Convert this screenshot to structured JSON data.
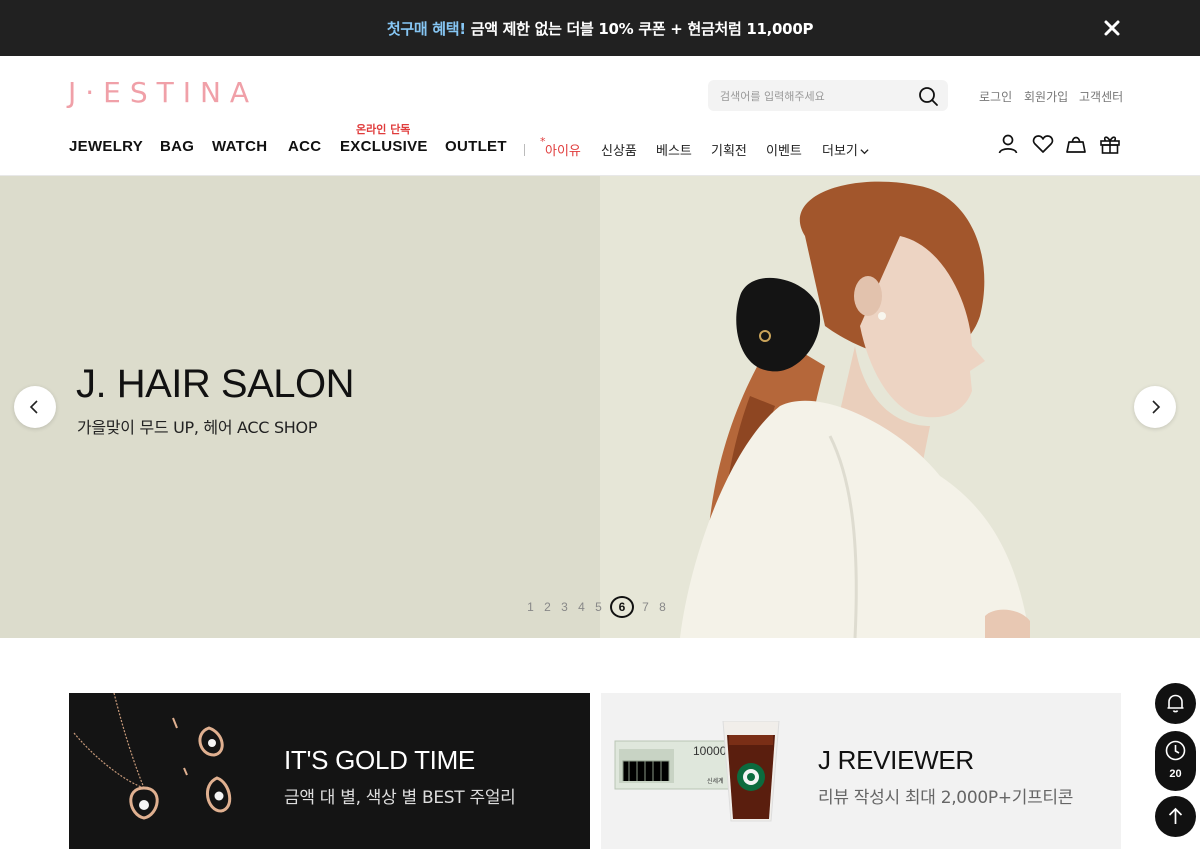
{
  "promo": {
    "highlight": "첫구매 혜택!",
    "text": " 금액 제한 없는 더블 10% 쿠폰 + 현금처럼 11,000P"
  },
  "header": {
    "logo": "J·ESTINA",
    "search_placeholder": "검색어를 입력해주세요",
    "util_links": [
      "로그인",
      "회원가입",
      "고객센터"
    ],
    "nav_en": [
      "JEWELRY",
      "BAG",
      "WATCH",
      "ACC",
      "EXCLUSIVE",
      "OUTLET"
    ],
    "exclusive_tag": "온라인 단독",
    "nav_ko": [
      {
        "star": "*",
        "label": "아이유"
      },
      {
        "label": "신상품"
      },
      {
        "label": "베스트"
      },
      {
        "label": "기획전"
      },
      {
        "label": "이벤트"
      },
      {
        "label": "더보기"
      }
    ],
    "icons": [
      "user-icon",
      "heart-icon",
      "bag-icon",
      "gift-icon"
    ]
  },
  "hero": {
    "title": "J. HAIR SALON",
    "subtitle": "가을맞이 무드 UP, 헤어 ACC SHOP",
    "pages": [
      "1",
      "2",
      "3",
      "4",
      "5",
      "6",
      "7",
      "8"
    ],
    "active_page": "6"
  },
  "banners": [
    {
      "title": "IT'S GOLD TIME",
      "subtitle": "금액 대 별, 색상 별 BEST 주얼리"
    },
    {
      "title": "J REVIEWER",
      "subtitle": "리뷰 작성시 최대 2,000P+기프티콘",
      "voucher_text": "10000",
      "voucher_brand": "신세계"
    }
  ],
  "floating": {
    "recent_count": "20"
  },
  "colors": {
    "promo_bg": "#212121",
    "promo_highlight": "#86c6f4",
    "logo": "#f0a0a8",
    "accent_red": "#e03c3c",
    "hero_bg": "#dcdccc"
  }
}
